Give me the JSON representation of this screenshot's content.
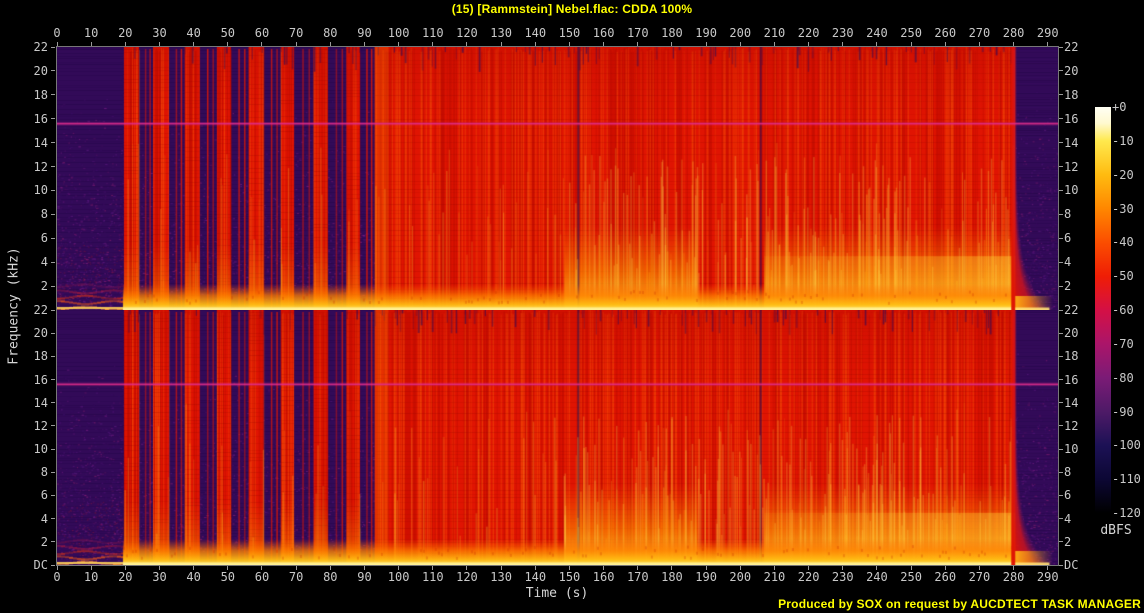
{
  "title": {
    "text": "(15) [Rammstein] Nebel.flac: CDDA 100%",
    "color": "#ffff00"
  },
  "credit": {
    "text": "Produced by SOX on request by AUCDTECT TASK MANAGER",
    "color": "#ffff00"
  },
  "chart_data": {
    "type": "heatmap",
    "subtype": "stereo-audio-spectrogram",
    "title": "(15) [Rammstein] Nebel.flac: CDDA 100%",
    "xlabel": "Time (s)",
    "ylabel": "Frequency (kHz)",
    "duration_s": 293,
    "freq_max_khz": 22,
    "x_ticks": [
      0,
      10,
      20,
      30,
      40,
      50,
      60,
      70,
      80,
      90,
      100,
      110,
      120,
      130,
      140,
      150,
      160,
      170,
      180,
      190,
      200,
      210,
      220,
      230,
      240,
      250,
      260,
      270,
      280,
      290
    ],
    "panels": [
      {
        "name": "channel-left",
        "y_ticks": [
          "22",
          "20",
          "18",
          "16",
          "14",
          "12",
          "10",
          "8",
          "6",
          "4",
          "2"
        ]
      },
      {
        "name": "channel-right",
        "y_ticks": [
          "22",
          "20",
          "18",
          "16",
          "14",
          "12",
          "10",
          "8",
          "6",
          "4",
          "2",
          "DC"
        ]
      }
    ],
    "colorbar": {
      "label": "dBFS",
      "ticks": [
        "+0",
        "-10",
        "-20",
        "-30",
        "-40",
        "-50",
        "-60",
        "-70",
        "-80",
        "-90",
        "-100",
        "-110",
        "-120"
      ],
      "stops": [
        {
          "at": 0,
          "color": "#fffff4"
        },
        {
          "at": 0.04,
          "color": "#fff9cf"
        },
        {
          "at": 0.083,
          "color": "#ffe94e"
        },
        {
          "at": 0.167,
          "color": "#ffbb10"
        },
        {
          "at": 0.25,
          "color": "#ff8700"
        },
        {
          "at": 0.333,
          "color": "#fb4e00"
        },
        {
          "at": 0.417,
          "color": "#ef1d05"
        },
        {
          "at": 0.5,
          "color": "#d41045"
        },
        {
          "at": 0.583,
          "color": "#ab1569"
        },
        {
          "at": 0.667,
          "color": "#7b1b76"
        },
        {
          "at": 0.75,
          "color": "#4e1a67"
        },
        {
          "at": 0.833,
          "color": "#1c1155"
        },
        {
          "at": 0.917,
          "color": "#0c0734"
        },
        {
          "at": 1,
          "color": "#000000"
        }
      ]
    },
    "palette": {
      "quiet_base": "#320a58",
      "speckles": [
        "#55157c",
        "#6d2090",
        "#8b2290",
        "#a02574",
        "#3f1070"
      ],
      "red": "#e01402",
      "dark_red": "#a80800",
      "orange": "#ff6e0a",
      "gold": "#ffb914",
      "yellow": "#ffe86e",
      "magenta_line": "#e12d8c"
    },
    "events": {
      "intro_end_s": 19.3,
      "pulses_s": [
        [
          19.6,
          24.0
        ],
        [
          28.1,
          32.8
        ],
        [
          37.4,
          41.8
        ],
        [
          46.8,
          50.9
        ],
        [
          56.1,
          60.5
        ],
        [
          65.5,
          69.4
        ],
        [
          75.1,
          79.3
        ],
        [
          84.7,
          88.7
        ]
      ],
      "chorus_start_s": 93,
      "low_glow_regions_s": [
        [
          148.5,
          187.5
        ],
        [
          207,
          280.5
        ]
      ],
      "quiet_gap_lines_s": [
        152.3,
        205.7
      ],
      "fade_start_s": 280.5,
      "fade_end_s": 293,
      "pilot_tone_khz": 15.65
    },
    "segments": [
      {
        "t0": 0,
        "t1": 19.3,
        "label": "quiet intro, energy only below ~2 kHz"
      },
      {
        "t0": 19.3,
        "t1": 93,
        "label": "verse: periodic loud full-band chord bursts over quiet background"
      },
      {
        "t0": 93,
        "t1": 148.5,
        "label": "full band, loud across all frequencies"
      },
      {
        "t0": 148.5,
        "t1": 187.5,
        "label": "loud with strong low-mid energy below ~7 kHz"
      },
      {
        "t0": 187.5,
        "t1": 207,
        "label": "bridge: low-mid glow drops out"
      },
      {
        "t0": 207,
        "t1": 280.5,
        "label": "final section: strongest low-mid energy"
      },
      {
        "t0": 280.5,
        "t1": 293,
        "label": "fade-out to silence"
      }
    ]
  }
}
